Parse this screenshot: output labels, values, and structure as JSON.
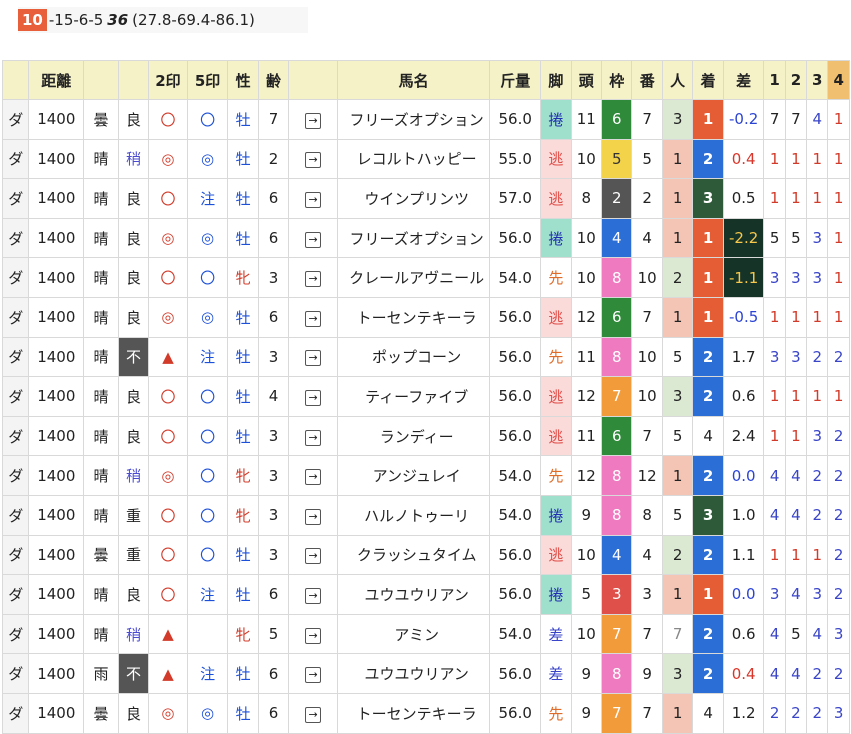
{
  "summary": {
    "badge": "10",
    "text": "-15-6-5",
    "bold": "36",
    "paren": "(27.8-69.4-86.1)"
  },
  "headers": [
    "",
    "距離",
    "",
    "",
    "2印",
    "5印",
    "性",
    "齢",
    "",
    "馬名",
    "斤量",
    "脚",
    "頭",
    "枠",
    "番",
    "人",
    "着",
    "差",
    "1",
    "2",
    "3",
    "4"
  ],
  "frame_colors": {
    "2": "#555555",
    "3": "#e0504a",
    "4": "#2a6ed6",
    "5": "#f3d34a",
    "6": "#2f8a3a",
    "7": "#f29b3a",
    "8": "#f07ac0"
  },
  "frame_text": {
    "5": "#333333"
  },
  "rows": [
    {
      "surface": "ダ",
      "dist": "1400",
      "weather": "曇",
      "cond": "良",
      "m2": "〇",
      "m5": "〇",
      "sex": "牡",
      "age": "7",
      "arrow": "→",
      "horse": "フリーズオプション",
      "kin": "56.0",
      "legs": "捲",
      "field": "11",
      "frame": "6",
      "num": "7",
      "pop": "3",
      "fin": "1",
      "diff": "-0.2",
      "p1": "7",
      "p2": "7",
      "p3": "4",
      "p4": "1"
    },
    {
      "surface": "ダ",
      "dist": "1400",
      "weather": "晴",
      "cond": "稍",
      "m2": "◎",
      "m5": "◎",
      "sex": "牡",
      "age": "2",
      "arrow": "→",
      "horse": "レコルトハッピー",
      "kin": "55.0",
      "legs": "逃",
      "field": "10",
      "frame": "5",
      "num": "5",
      "pop": "1",
      "fin": "2",
      "diff": "0.4",
      "p1": "1",
      "p2": "1",
      "p3": "1",
      "p4": "1"
    },
    {
      "surface": "ダ",
      "dist": "1400",
      "weather": "晴",
      "cond": "良",
      "m2": "〇",
      "m5": "注",
      "sex": "牡",
      "age": "6",
      "arrow": "→",
      "horse": "ウインプリンツ",
      "kin": "57.0",
      "legs": "逃",
      "field": "8",
      "frame": "2",
      "num": "2",
      "pop": "1",
      "fin": "3",
      "diff": "0.5",
      "p1": "1",
      "p2": "1",
      "p3": "1",
      "p4": "1"
    },
    {
      "surface": "ダ",
      "dist": "1400",
      "weather": "晴",
      "cond": "良",
      "m2": "◎",
      "m5": "◎",
      "sex": "牡",
      "age": "6",
      "arrow": "→",
      "horse": "フリーズオプション",
      "kin": "56.0",
      "legs": "捲",
      "field": "10",
      "frame": "4",
      "num": "4",
      "pop": "1",
      "fin": "1",
      "diff": "-2.2",
      "p1": "5",
      "p2": "5",
      "p3": "3",
      "p4": "1"
    },
    {
      "surface": "ダ",
      "dist": "1400",
      "weather": "晴",
      "cond": "良",
      "m2": "〇",
      "m5": "〇",
      "sex": "牝",
      "age": "3",
      "arrow": "→",
      "horse": "クレールアヴニール",
      "kin": "54.0",
      "legs": "先",
      "field": "10",
      "frame": "8",
      "num": "10",
      "pop": "2",
      "fin": "1",
      "diff": "-1.1",
      "p1": "3",
      "p2": "3",
      "p3": "3",
      "p4": "1"
    },
    {
      "surface": "ダ",
      "dist": "1400",
      "weather": "晴",
      "cond": "良",
      "m2": "◎",
      "m5": "◎",
      "sex": "牡",
      "age": "6",
      "arrow": "→",
      "horse": "トーセンテキーラ",
      "kin": "56.0",
      "legs": "逃",
      "field": "12",
      "frame": "6",
      "num": "7",
      "pop": "1",
      "fin": "1",
      "diff": "-0.5",
      "p1": "1",
      "p2": "1",
      "p3": "1",
      "p4": "1"
    },
    {
      "surface": "ダ",
      "dist": "1400",
      "weather": "晴",
      "cond": "不",
      "m2": "▲",
      "m5": "注",
      "sex": "牡",
      "age": "3",
      "arrow": "→",
      "horse": "ポップコーン",
      "kin": "56.0",
      "legs": "先",
      "field": "11",
      "frame": "8",
      "num": "10",
      "pop": "5",
      "fin": "2",
      "diff": "1.7",
      "p1": "3",
      "p2": "3",
      "p3": "2",
      "p4": "2"
    },
    {
      "surface": "ダ",
      "dist": "1400",
      "weather": "晴",
      "cond": "良",
      "m2": "〇",
      "m5": "〇",
      "sex": "牡",
      "age": "4",
      "arrow": "→",
      "horse": "ティーファイブ",
      "kin": "56.0",
      "legs": "逃",
      "field": "12",
      "frame": "7",
      "num": "10",
      "pop": "3",
      "fin": "2",
      "diff": "0.6",
      "p1": "1",
      "p2": "1",
      "p3": "1",
      "p4": "1"
    },
    {
      "surface": "ダ",
      "dist": "1400",
      "weather": "晴",
      "cond": "良",
      "m2": "〇",
      "m5": "〇",
      "sex": "牡",
      "age": "3",
      "arrow": "→",
      "horse": "ランディー",
      "kin": "56.0",
      "legs": "逃",
      "field": "11",
      "frame": "6",
      "num": "7",
      "pop": "5",
      "fin": "4",
      "diff": "2.4",
      "p1": "1",
      "p2": "1",
      "p3": "3",
      "p4": "2"
    },
    {
      "surface": "ダ",
      "dist": "1400",
      "weather": "晴",
      "cond": "稍",
      "m2": "◎",
      "m5": "〇",
      "sex": "牝",
      "age": "3",
      "arrow": "→",
      "horse": "アンジュレイ",
      "kin": "54.0",
      "legs": "先",
      "field": "12",
      "frame": "8",
      "num": "12",
      "pop": "1",
      "fin": "2",
      "diff": "0.0",
      "p1": "4",
      "p2": "4",
      "p3": "2",
      "p4": "2"
    },
    {
      "surface": "ダ",
      "dist": "1400",
      "weather": "晴",
      "cond": "重",
      "m2": "〇",
      "m5": "〇",
      "sex": "牝",
      "age": "3",
      "arrow": "→",
      "horse": "ハルノトゥーリ",
      "kin": "54.0",
      "legs": "捲",
      "field": "9",
      "frame": "8",
      "num": "8",
      "pop": "5",
      "fin": "3",
      "diff": "1.0",
      "p1": "4",
      "p2": "4",
      "p3": "2",
      "p4": "2"
    },
    {
      "surface": "ダ",
      "dist": "1400",
      "weather": "曇",
      "cond": "重",
      "m2": "〇",
      "m5": "〇",
      "sex": "牡",
      "age": "3",
      "arrow": "→",
      "horse": "クラッシュタイム",
      "kin": "56.0",
      "legs": "逃",
      "field": "10",
      "frame": "4",
      "num": "4",
      "pop": "2",
      "fin": "2",
      "diff": "1.1",
      "p1": "1",
      "p2": "1",
      "p3": "1",
      "p4": "2"
    },
    {
      "surface": "ダ",
      "dist": "1400",
      "weather": "晴",
      "cond": "良",
      "m2": "〇",
      "m5": "注",
      "sex": "牡",
      "age": "6",
      "arrow": "→",
      "horse": "ユウユウリアン",
      "kin": "56.0",
      "legs": "捲",
      "field": "5",
      "frame": "3",
      "num": "3",
      "pop": "1",
      "fin": "1",
      "diff": "0.0",
      "p1": "3",
      "p2": "4",
      "p3": "3",
      "p4": "2"
    },
    {
      "surface": "ダ",
      "dist": "1400",
      "weather": "晴",
      "cond": "稍",
      "m2": "▲",
      "m5": "",
      "sex": "牝",
      "age": "5",
      "arrow": "→",
      "horse": "アミン",
      "kin": "54.0",
      "legs": "差",
      "field": "10",
      "frame": "7",
      "num": "7",
      "pop": "7",
      "fin": "2",
      "diff": "0.6",
      "p1": "4",
      "p2": "5",
      "p3": "4",
      "p4": "3"
    },
    {
      "surface": "ダ",
      "dist": "1400",
      "weather": "雨",
      "cond": "不",
      "m2": "▲",
      "m5": "注",
      "sex": "牡",
      "age": "6",
      "arrow": "→",
      "horse": "ユウユウリアン",
      "kin": "56.0",
      "legs": "差",
      "field": "9",
      "frame": "8",
      "num": "9",
      "pop": "3",
      "fin": "2",
      "diff": "0.4",
      "p1": "4",
      "p2": "4",
      "p3": "2",
      "p4": "2"
    },
    {
      "surface": "ダ",
      "dist": "1400",
      "weather": "曇",
      "cond": "良",
      "m2": "◎",
      "m5": "◎",
      "sex": "牡",
      "age": "6",
      "arrow": "→",
      "horse": "トーセンテキーラ",
      "kin": "56.0",
      "legs": "先",
      "field": "9",
      "frame": "7",
      "num": "7",
      "pop": "1",
      "fin": "4",
      "diff": "1.2",
      "p1": "2",
      "p2": "2",
      "p3": "2",
      "p4": "3"
    }
  ]
}
